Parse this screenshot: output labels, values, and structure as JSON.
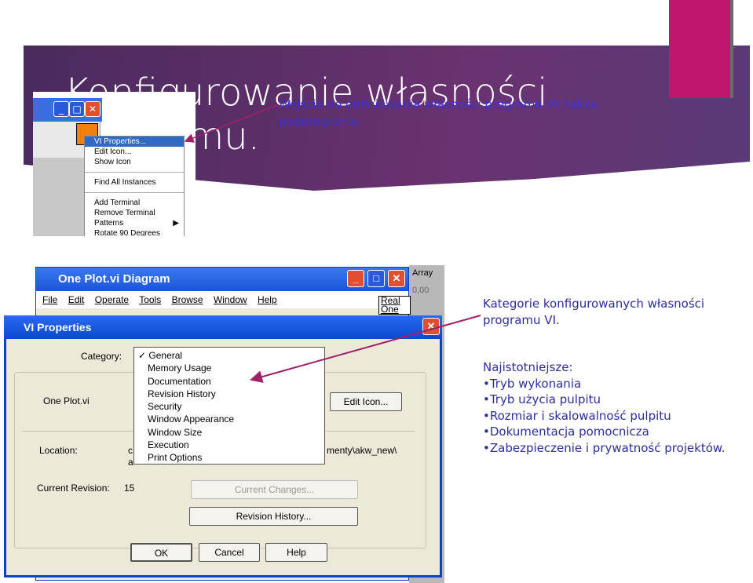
{
  "slide": {
    "title": "Konfigurowanie własności programu.",
    "note_top": "Wejście do definiowania własności programu VI; także podprogramu.",
    "note_categories": "Kategorie konfigurowanych własności programu VI.",
    "important_heading": "Najistotniejsze:",
    "important_items": [
      "•Tryb wykonania",
      "•Tryb użycia pulpitu",
      "•Rozmiar i skalowalność pulpitu",
      "•Dokumentacja pomocnicza",
      "•Zabezpieczenie i prywatność projektów."
    ],
    "colors": {
      "banner": "#5e2f6c",
      "accent": "#c0166e",
      "note_text": "#2e2e9a",
      "arrow": "#a0206a"
    }
  },
  "context_menu": {
    "items": [
      "VI Properties...",
      "Edit Icon...",
      "Show Icon",
      "Find All Instances",
      "Add Terminal",
      "Remove Terminal",
      "Patterns",
      "Rotate 90 Degrees"
    ],
    "selected": "VI Properties..."
  },
  "diagram_window": {
    "title": "One Plot.vi Diagram",
    "menu": [
      "File",
      "Edit",
      "Operate",
      "Tools",
      "Browse",
      "Window",
      "Help"
    ],
    "right_label_1": "Real",
    "right_label_2": "One",
    "side_panel_label": "Array",
    "side_panel_value": "0,00"
  },
  "vi_properties": {
    "title": "VI Properties",
    "category_label": "Category:",
    "categories": [
      "General",
      "Memory Usage",
      "Documentation",
      "Revision History",
      "Security",
      "Window Appearance",
      "Window Size",
      "Execution",
      "Print Options"
    ],
    "selected_category": "General",
    "vi_name": "One Plot.vi",
    "edit_icon": "Edit Icon...",
    "location_label": "Location:",
    "location_prefix": "c",
    "location_line2": "a",
    "location_suffix": "menty\\akw_new\\",
    "current_revision_label": "Current Revision:",
    "current_revision": "15",
    "current_changes": "Current Changes...",
    "revision_history": "Revision History...",
    "ok": "OK",
    "cancel": "Cancel",
    "help": "Help"
  }
}
